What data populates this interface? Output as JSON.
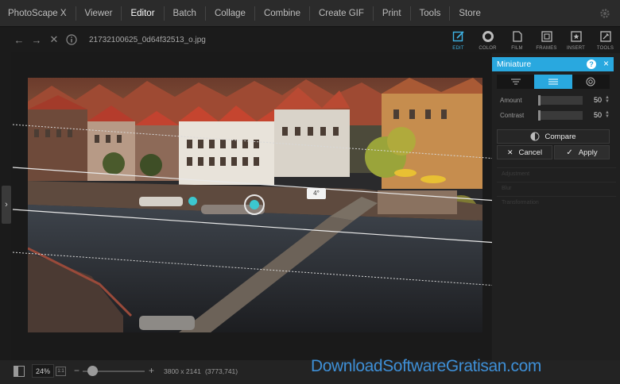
{
  "menu": {
    "items": [
      "PhotoScape X",
      "Viewer",
      "Editor",
      "Batch",
      "Collage",
      "Combine",
      "Create GIF",
      "Print",
      "Tools",
      "Store"
    ],
    "active": "Editor"
  },
  "filebar": {
    "filename": "21732100625_0d64f32513_o.jpg"
  },
  "tool_tabs": [
    {
      "label": "EDIT",
      "icon": "edit-icon",
      "active": true
    },
    {
      "label": "COLOR",
      "icon": "color-icon",
      "active": false
    },
    {
      "label": "FILM",
      "icon": "film-icon",
      "active": false
    },
    {
      "label": "FRAMES",
      "icon": "frames-icon",
      "active": false
    },
    {
      "label": "INSERT",
      "icon": "insert-icon",
      "active": false
    },
    {
      "label": "TOOLS",
      "icon": "tools-icon",
      "active": false
    }
  ],
  "panel": {
    "title": "Miniature",
    "help_label": "?",
    "close_label": "×",
    "modes": [
      "linear-top-icon",
      "linear-band-icon",
      "radial-icon"
    ],
    "active_mode": 1,
    "amount": {
      "label": "Amount",
      "value": "50",
      "level": 0.5
    },
    "contrast": {
      "label": "Contrast",
      "value": "50",
      "level": 0.5
    },
    "compare_label": "Compare",
    "cancel_label": "Cancel",
    "apply_label": "Apply",
    "collapsed_sections": [
      "Adjustment",
      "Blur",
      "Transformation"
    ]
  },
  "canvas": {
    "angle_label": "4°"
  },
  "status": {
    "zoom": "24%",
    "one_to_one": "1:1",
    "zoom_minus": "−",
    "zoom_plus": "+",
    "dimensions": "3800 x 2141",
    "coordinates": "(3773,741)"
  },
  "watermark": "DownloadSoftwareGratisan.com",
  "colors": {
    "accent": "#29a8df",
    "menubar": "#2b2b2b",
    "background": "#1b1b1b"
  }
}
